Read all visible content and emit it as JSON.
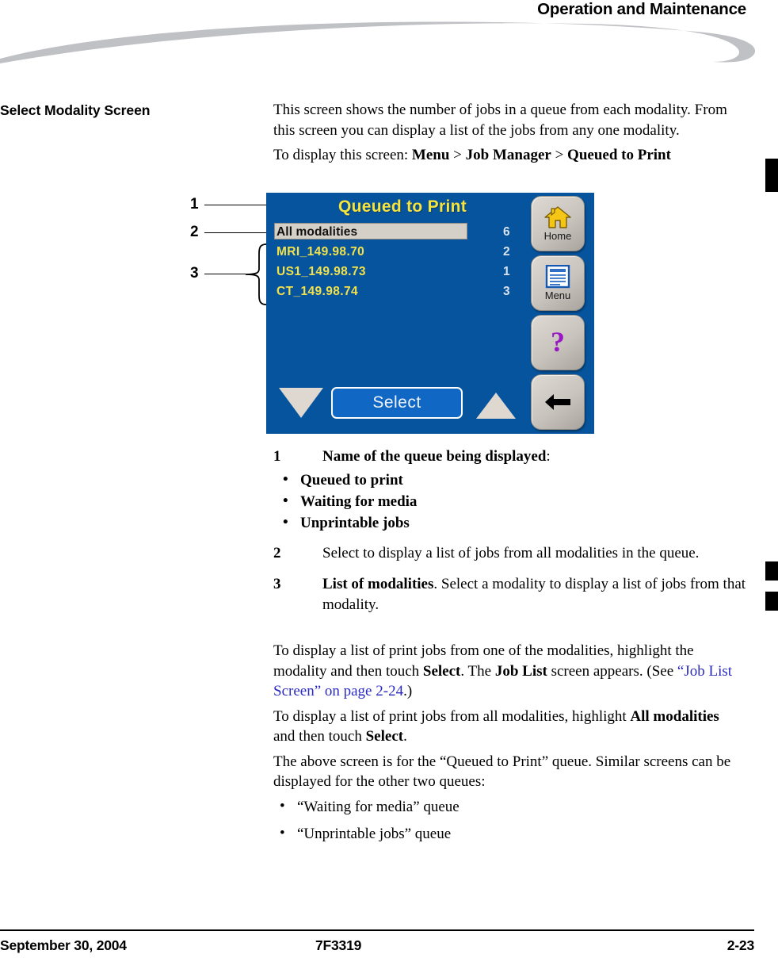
{
  "header": {
    "running_title": "Operation and Maintenance",
    "swoosh_color": "#c0c1c5"
  },
  "section": {
    "heading": "Select Modality Screen",
    "intro_paragraph": "This screen shows the number of jobs in a queue from each modality. From this screen you can display a list of the jobs from any one modality.",
    "navigation_lead": "To display this screen: ",
    "navigation_path": "Menu > Job Manager > Queued to Print",
    "nav_menu": "Menu",
    "nav_sep": " > ",
    "nav_job_manager": "Job Manager",
    "nav_queued_to_print": "Queued to Print"
  },
  "figure": {
    "callouts": [
      {
        "number": "1",
        "target": "screen-title"
      },
      {
        "number": "2",
        "target": "all-modalities-row"
      },
      {
        "number": "3",
        "target": "modality-list"
      }
    ],
    "device_screen": {
      "background_color": "#05549d",
      "title": "Queued to Print",
      "title_color": "#f5e43c",
      "rows": [
        {
          "name": "All modalities",
          "count": "6",
          "selected": true
        },
        {
          "name": "MRI_149.98.70",
          "count": "2",
          "selected": false
        },
        {
          "name": "US1_149.98.73",
          "count": "1",
          "selected": false
        },
        {
          "name": "CT_149.98.74",
          "count": "3",
          "selected": false
        }
      ],
      "controls": {
        "scroll_down": "scroll-down-triangle",
        "select_label": "Select",
        "scroll_up": "scroll-up-triangle"
      },
      "hard_buttons": [
        {
          "label": "Home",
          "icon": "home-icon"
        },
        {
          "label": "Menu",
          "icon": "menu-document-icon"
        },
        {
          "label": "",
          "icon": "help-question-mark-icon"
        },
        {
          "label": "",
          "icon": "back-arrow-icon"
        }
      ]
    }
  },
  "legend": {
    "item1": {
      "number": "1",
      "lead_bold": "Name of the queue being displayed",
      "lead_tail": ":",
      "options": [
        "Queued to print",
        "Waiting for media",
        "Unprintable jobs"
      ]
    },
    "item2": {
      "number": "2",
      "text": "Select to display a list of jobs from all modalities in the queue."
    },
    "item3": {
      "number": "3",
      "lead_bold": "List of modalities",
      "text": ". Select a modality to display a list of jobs from that modality."
    }
  },
  "tail": {
    "p1_a": "To display a list of print jobs from one of the modalities, highlight the modality and then touch ",
    "p1_b": "Select",
    "p1_c": ". The ",
    "p1_d": "Job List",
    "p1_e": " screen appears. (See ",
    "p1_link": "“Job List Screen” on page 2-24",
    "p1_f": ".)",
    "p2_a": "To display a list of print jobs from all modalities, highlight ",
    "p2_b": "All modalities",
    "p2_c": " and then touch ",
    "p2_d": "Select",
    "p2_e": ".",
    "p3": "The above screen is for the “Queued to Print” queue. Similar screens can be displayed for the other two queues:",
    "bullets": [
      "“Waiting for media” queue",
      "“Unprintable jobs” queue"
    ]
  },
  "footer": {
    "date": "September 30, 2004",
    "doc_number": "7F3319",
    "page_number": "2-23"
  }
}
